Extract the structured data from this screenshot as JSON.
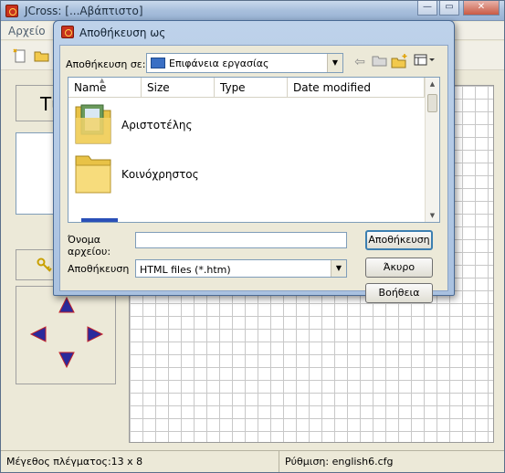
{
  "main_window": {
    "title": "JCross: [...Αβάπτιστο]",
    "menu": {
      "file_label": "Αρχείο"
    },
    "left_panel": {
      "title_glyph": "Tί"
    },
    "status": {
      "grid_size": "Μέγεθος πλέγματος:13 x 8",
      "config": "Ρύθμιση: english6.cfg"
    },
    "grid": {
      "columns": 13,
      "rows": 8
    }
  },
  "dialog": {
    "title": "Αποθήκευση ως",
    "save_in_label": "Αποθήκευση σε:",
    "save_in_value": "Επιφάνεια εργασίας",
    "columns": [
      "Name",
      "Size",
      "Type",
      "Date modified"
    ],
    "files": [
      {
        "name": "Αριστοτέλης",
        "icon": "user-folder-icon"
      },
      {
        "name": "Κοινόχρηστος",
        "icon": "folder-icon"
      }
    ],
    "filename_label": "Όνομα αρχείου:",
    "filename_value": "",
    "savetype_label": "Αποθήκευση",
    "savetype_value": "HTML files (*.htm)",
    "buttons": {
      "save": "Αποθήκευση",
      "cancel": "Άκυρο",
      "help": "Βοήθεια"
    }
  },
  "colors": {
    "accent": "#3c7fb1",
    "folder": "#f2c94c",
    "arrow": "#2a2a9c"
  }
}
